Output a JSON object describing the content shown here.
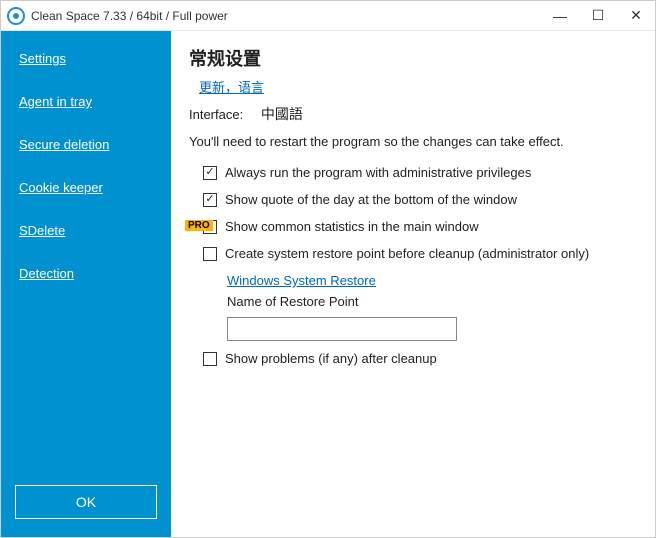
{
  "window": {
    "title": "Clean Space 7.33 / 64bit / Full power"
  },
  "sidebar": {
    "items": [
      {
        "label": "Settings"
      },
      {
        "label": "Agent in tray"
      },
      {
        "label": "Secure deletion"
      },
      {
        "label": "Cookie keeper"
      },
      {
        "label": "SDelete"
      },
      {
        "label": "Detection"
      }
    ],
    "ok_label": "OK"
  },
  "main": {
    "heading": "常规设置",
    "update_link": "更新，语言",
    "interface_label": "Interface:",
    "interface_value": "中國語",
    "restart_note": "You'll need to restart the program so the changes can take effect.",
    "opt_admin": "Always run the program with administrative privileges",
    "opt_quote": "Show quote of the day at the bottom of the window",
    "opt_stats": "Show common statistics in the main window",
    "opt_restore": "Create system restore point before cleanup (administrator only)",
    "restore_link": "Windows System Restore",
    "restore_name_label": "Name of Restore Point",
    "restore_name_value": "",
    "opt_problems": "Show problems (if any) after cleanup",
    "pro_badge": "PRO"
  }
}
